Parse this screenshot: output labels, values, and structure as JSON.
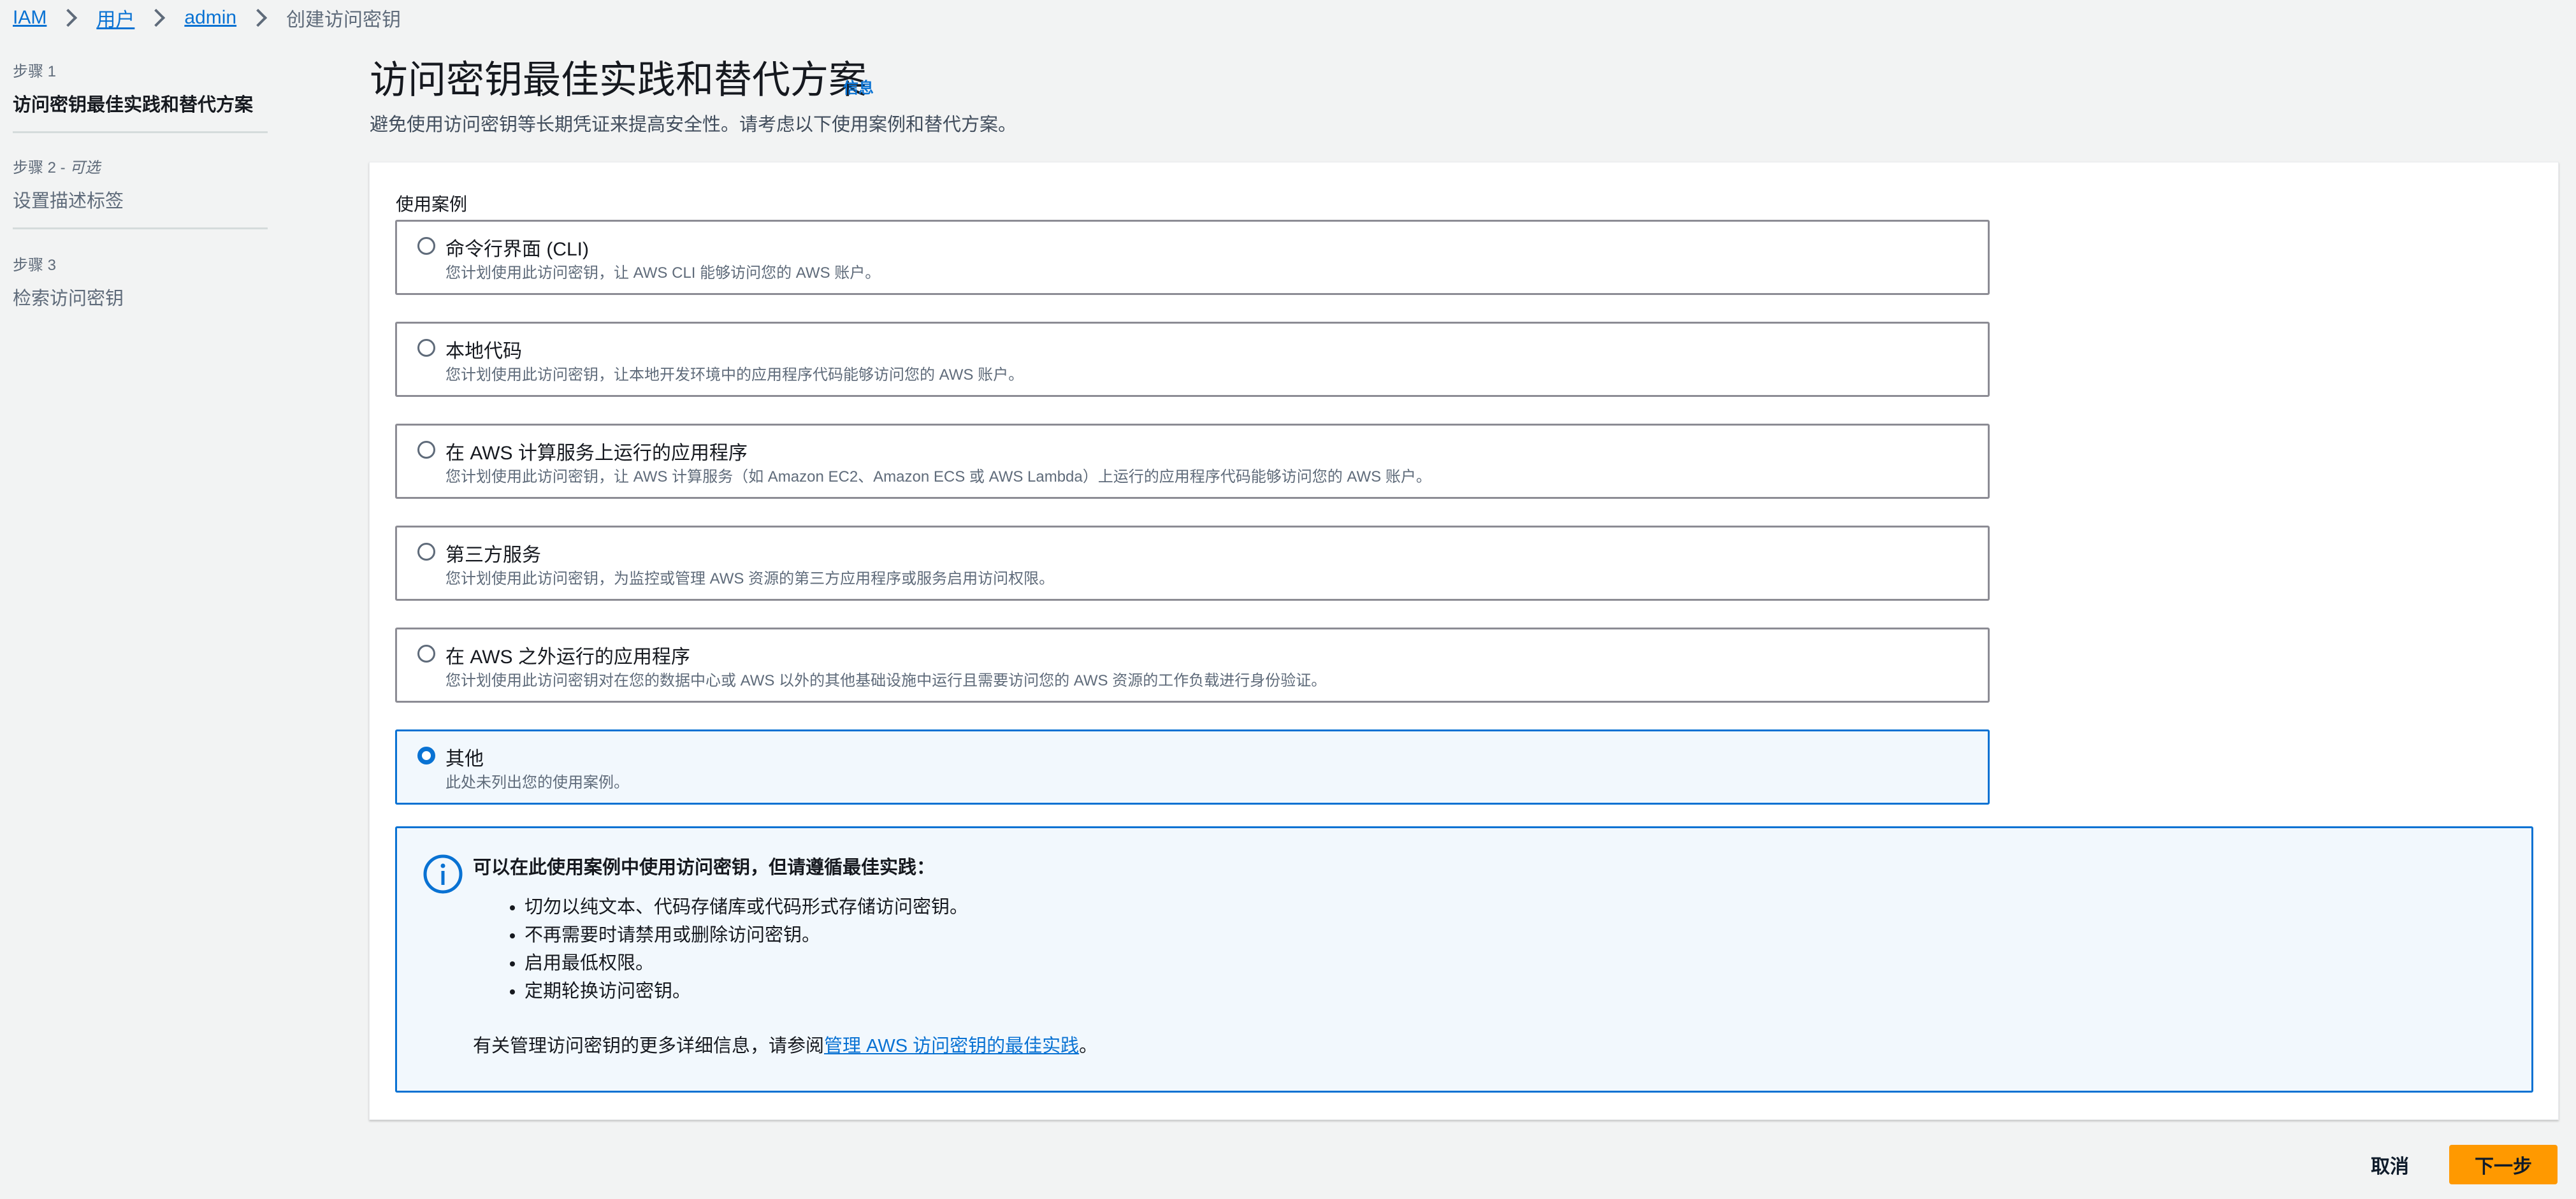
{
  "breadcrumb": {
    "items": [
      {
        "label": "IAM"
      },
      {
        "label": "用户"
      },
      {
        "label": "admin"
      }
    ],
    "current": "创建访问密钥"
  },
  "steps": [
    {
      "number": "步骤 1",
      "title": "访问密钥最佳实践和替代方案",
      "active": true
    },
    {
      "number": "步骤 2",
      "optional": "可选",
      "title": "设置描述标签",
      "active": false
    },
    {
      "number": "步骤 3",
      "title": "检索访问密钥",
      "active": false
    }
  ],
  "header": {
    "title": "访问密钥最佳实践和替代方案",
    "info_link": "信息",
    "description": "避免使用访问密钥等长期凭证来提高安全性。请考虑以下使用案例和替代方案。"
  },
  "use_cases": {
    "label": "使用案例",
    "selected_index": 5,
    "options": [
      {
        "title": "命令行界面 (CLI)",
        "description": "您计划使用此访问密钥，让 AWS CLI 能够访问您的 AWS 账户。"
      },
      {
        "title": "本地代码",
        "description": "您计划使用此访问密钥，让本地开发环境中的应用程序代码能够访问您的 AWS 账户。"
      },
      {
        "title": "在 AWS 计算服务上运行的应用程序",
        "description": "您计划使用此访问密钥，让 AWS 计算服务（如 Amazon EC2、Amazon ECS 或 AWS Lambda）上运行的应用程序代码能够访问您的 AWS 账户。"
      },
      {
        "title": "第三方服务",
        "description": "您计划使用此访问密钥，为监控或管理 AWS 资源的第三方应用程序或服务启用访问权限。"
      },
      {
        "title": "在 AWS 之外运行的应用程序",
        "description": "您计划使用此访问密钥对在您的数据中心或 AWS 以外的其他基础设施中运行且需要访问您的 AWS 资源的工作负载进行身份验证。"
      },
      {
        "title": "其他",
        "description": "此处未列出您的使用案例。"
      }
    ]
  },
  "alert": {
    "icon": "info-icon",
    "title": "可以在此使用案例中使用访问密钥，但请遵循最佳实践：",
    "items": [
      "切勿以纯文本、代码存储库或代码形式存储访问密钥。",
      "不再需要时请禁用或删除访问密钥。",
      "启用最低权限。",
      "定期轮换访问密钥。"
    ],
    "footer_prefix": "有关管理访问密钥的更多详细信息，请参阅",
    "footer_link": "管理 AWS 访问密钥的最佳实践",
    "footer_suffix": "。"
  },
  "actions": {
    "cancel": "取消",
    "next": "下一步"
  },
  "colors": {
    "accent": "#0972d3",
    "primary_button": "#ff9900",
    "background": "#f2f3f3"
  }
}
